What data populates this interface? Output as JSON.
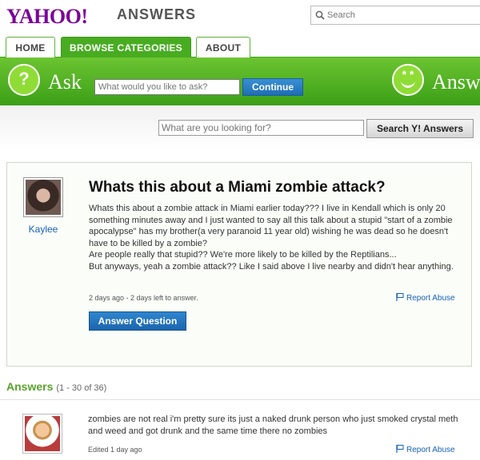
{
  "header": {
    "logo": "YAHOO!",
    "product": "ANSWERS",
    "search_placeholder": "Search"
  },
  "tabs": [
    {
      "label": "HOME",
      "active": false
    },
    {
      "label": "BROWSE CATEGORIES",
      "active": true
    },
    {
      "label": "ABOUT",
      "active": false
    }
  ],
  "askbar": {
    "ask_label": "Ask",
    "ask_placeholder": "What would you like to ask?",
    "continue_label": "Continue",
    "answer_label": "Answer"
  },
  "search": {
    "placeholder": "What are you looking for?",
    "button_label": "Search Y! Answers"
  },
  "question": {
    "asker": "Kaylee",
    "title": "Whats this about a Miami zombie attack?",
    "body": [
      "Whats this about a zombie attack in Miami earlier today??? I live in Kendall which is only 20 something minutes away and I just wanted to say all this talk about a stupid \"start of a zombie apocalypse\" has my brother(a very paranoid 11 year old) wishing he was dead so he doesn't have to be killed by a zombie?",
      "Are people really that stupid?? We're more likely to be killed by the Reptilians...",
      "But anyways, yeah a zombie attack?? Like I said above I live nearby and didn't hear anything."
    ],
    "meta": "2 days ago - 2 days left to answer.",
    "report_label": "Report Abuse",
    "answer_button": "Answer Question"
  },
  "answers": {
    "heading": "Answers",
    "count": "(1 - 30 of 36)",
    "items": [
      {
        "body": "zombies are not real i'm pretty sure its just a naked drunk person who just smoked crystal meth and weed and got drunk and the same time there no zombies",
        "meta": "Edited 1 day ago",
        "report_label": "Report Abuse"
      }
    ]
  },
  "colors": {
    "brand_purple": "#7b0099",
    "green": "#48ac21",
    "link_blue": "#1560bd",
    "button_blue": "#1e6eb6"
  }
}
